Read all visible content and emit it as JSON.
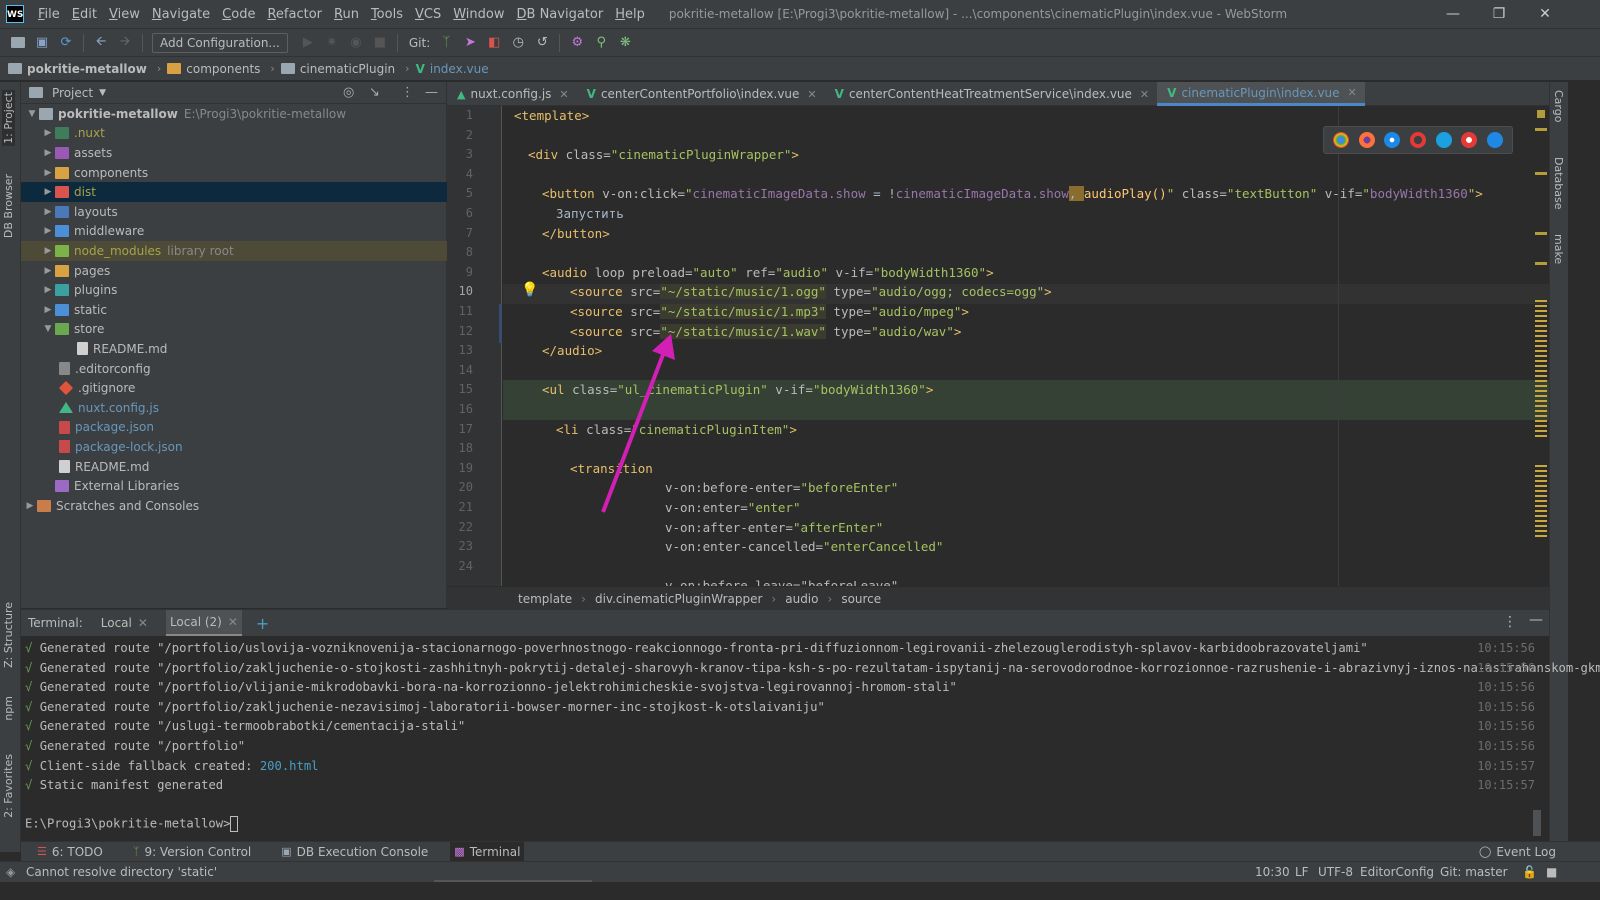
{
  "window": {
    "title": "pokritie-metallow [E:\\Progi3\\pokritie-metallow] - ...\\components\\cinematicPlugin\\index.vue - WebStorm",
    "logo": "WS"
  },
  "menu": [
    "File",
    "Edit",
    "View",
    "Navigate",
    "Code",
    "Refactor",
    "Run",
    "Tools",
    "VCS",
    "Window",
    "DB Navigator",
    "Help"
  ],
  "toolbar": {
    "add_configuration": "Add Configuration...",
    "git_label": "Git:"
  },
  "nav_breadcrumb": [
    "pokritie-metallow",
    "components",
    "cinematicPlugin",
    "index.vue"
  ],
  "left_strip": {
    "project": "1: Project",
    "db_browser": "DB Browser",
    "structure": "Z: Structure",
    "npm": "npm",
    "favorites": "2: Favorites"
  },
  "right_strip": {
    "cargo": "Cargo",
    "database": "Database",
    "make": "make"
  },
  "project_panel": {
    "title": "Project",
    "tree": [
      {
        "label": "pokritie-metallow",
        "extra": "E:\\Progi3\\pokritie-metallow"
      },
      {
        "label": ".nuxt"
      },
      {
        "label": "assets"
      },
      {
        "label": "components"
      },
      {
        "label": "dist"
      },
      {
        "label": "layouts"
      },
      {
        "label": "middleware"
      },
      {
        "label": "node_modules",
        "extra": "library root"
      },
      {
        "label": "pages"
      },
      {
        "label": "plugins"
      },
      {
        "label": "static"
      },
      {
        "label": "store"
      },
      {
        "label": "README.md"
      },
      {
        "label": ".editorconfig"
      },
      {
        "label": ".gitignore"
      },
      {
        "label": "nuxt.config.js"
      },
      {
        "label": "package.json"
      },
      {
        "label": "package-lock.json"
      },
      {
        "label": "README.md"
      },
      {
        "label": "External Libraries"
      },
      {
        "label": "Scratches and Consoles"
      }
    ]
  },
  "tabs": [
    {
      "label": "nuxt.config.js"
    },
    {
      "label": "centerContentPortfolio\\index.vue"
    },
    {
      "label": "centerContentHeatTreatmentService\\index.vue"
    },
    {
      "label": "cinematicPlugin\\index.vue"
    }
  ],
  "line_numbers": [
    "1",
    "2",
    "3",
    "4",
    "5",
    "6",
    "7",
    "8",
    "9",
    "10",
    "11",
    "12",
    "13",
    "14",
    "15",
    "16",
    "17",
    "18",
    "19",
    "20",
    "21",
    "22",
    "23",
    "24"
  ],
  "code": {
    "l1": "<template>",
    "l3_a": "<div ",
    "l3_b": "class=",
    "l3_c": "\"cinematicPluginWrapper\"",
    "l3_d": ">",
    "l5_a": "<button ",
    "l5_b": "v-on:click=",
    "l5_c": "\"",
    "l5_d": "cinematicImageData.show",
    "l5_e": " = !",
    "l5_f": "cinematicImageData.show",
    "l5_g": ", ",
    "l5_h": "audioPlay()",
    "l5_i": "\"",
    "l5_j": " class=",
    "l5_k": "\"textButton\"",
    "l5_l": " v-if=",
    "l5_m": "\"",
    "l5_n": "bodyWidth1360",
    "l5_o": "\"",
    "l5_p": ">",
    "l6": "Запустить",
    "l7": "</button>",
    "l9_a": "<audio ",
    "l9_b": "loop preload=",
    "l9_c": "\"auto\"",
    "l9_d": " ref=",
    "l9_e": "\"audio\"",
    "l9_f": " v-if=",
    "l9_g": "\"bodyWidth1360\"",
    "l9_h": ">",
    "l10_a": "<source ",
    "l10_b": "src=",
    "l10_c": "\"~/static/music/1.ogg\"",
    "l10_d": " type=",
    "l10_e": "\"audio/ogg; codecs=ogg\"",
    "l10_f": ">",
    "l11_a": "<source ",
    "l11_b": "src=",
    "l11_c": "\"~/static/music/1.mp3\"",
    "l11_d": " type=",
    "l11_e": "\"audio/mpeg\"",
    "l11_f": ">",
    "l12_a": "<source ",
    "l12_b": "src=",
    "l12_c": "\"~/static/music/1.wav\"",
    "l12_d": " type=",
    "l12_e": "\"audio/wav\"",
    "l12_f": ">",
    "l13": "</audio>",
    "l15_a": "<ul ",
    "l15_b": "class=",
    "l15_c": "\"ul_cinematicPlugin\"",
    "l15_d": " v-if=",
    "l15_e": "\"bodyWidth1360\"",
    "l15_f": ">",
    "l17_a": "<li ",
    "l17_b": "class=",
    "l17_c": "\"cinematicPluginItem\"",
    "l17_d": ">",
    "l19": "<transition",
    "l20_a": "v-on:before-enter=",
    "l20_b": "\"beforeEnter\"",
    "l21_a": "v-on:enter=",
    "l21_b": "\"enter\"",
    "l22_a": "v-on:after-enter=",
    "l22_b": "\"afterEnter\"",
    "l23_a": "v-on:enter-cancelled=",
    "l23_b": "\"enterCancelled\"",
    "l24": "v-on:before-leave=\"beforeLeave\""
  },
  "editor_breadcrumb": [
    "template",
    "div.cinematicPluginWrapper",
    "audio",
    "source"
  ],
  "terminal": {
    "label": "Terminal:",
    "tabs": [
      "Local",
      "Local (2)"
    ],
    "lines": [
      {
        "text": "Generated route \"/portfolio/uslovija-vozniknovenija-stacionarnogo-poverhnostnogo-reakcionnogo-fronta-pri-diffuzionnom-legirovanii-zhelezouglerodistyh-splavov-karbidoobrazovateljami\"",
        "time": "10:15:56"
      },
      {
        "text": "Generated route \"/portfolio/zakljuchenie-o-stojkosti-zashhitnyh-pokrytij-detalej-sharovyh-kranov-tipa-ksh-s-po-rezultatam-ispytanij-na-serovodorodnoe-korrozionnoe-razrushenie-i-abrazivnyj-iznos-na-astrahanskom-gkm\"",
        "time": "10:15:56"
      },
      {
        "text": "Generated route \"/portfolio/vlijanie-mikrodobavki-bora-na-korrozionno-jelektrohimicheskie-svojstva-legirovannoj-hromom-stali\"",
        "time": "10:15:56"
      },
      {
        "text": "Generated route \"/portfolio/zakljuchenie-nezavisimoj-laboratorii-bowser-morner-inc-stojkost-k-otslaivaniju\"",
        "time": "10:15:56"
      },
      {
        "text": "Generated route \"/uslugi-termoobrabotki/cementacija-stali\"",
        "time": "10:15:56"
      },
      {
        "text": "Generated route \"/portfolio\"",
        "time": "10:15:56"
      },
      {
        "text": "Client-side fallback created: ",
        "link": "200.html",
        "time": "10:15:57"
      },
      {
        "text": "Static manifest generated",
        "time": "10:15:57"
      }
    ],
    "check": "√",
    "prompt": "E:\\Progi3\\pokritie-metallow>"
  },
  "tool_windows": [
    {
      "label": "6: TODO"
    },
    {
      "label": "9: Version Control"
    },
    {
      "label": "DB Execution Console"
    },
    {
      "label": "Terminal"
    }
  ],
  "event_log": "Event Log",
  "status": {
    "message": "Cannot resolve directory 'static'",
    "position": "10:30",
    "line_sep": "LF",
    "encoding": "UTF-8",
    "editor_config": "EditorConfig",
    "git_branch": "Git: master"
  },
  "colors": {
    "accent": "#4a88c7",
    "arrow": "#d21fb4",
    "selection": "#0d293e"
  }
}
